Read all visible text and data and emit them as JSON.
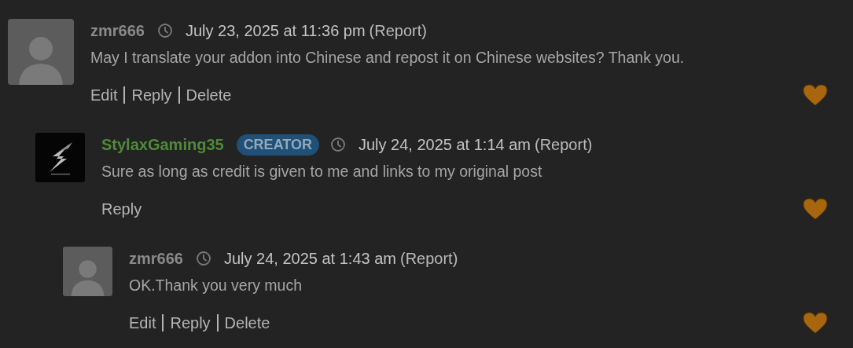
{
  "comments": [
    {
      "author": "zmr666",
      "avatar": {
        "kind": "default"
      },
      "date": "July 23, 2025 at 11:36 pm",
      "report": "(Report)",
      "text": "May I translate your addon into Chinese and repost it on Chinese websites? Thank you.",
      "actions": [
        "Edit",
        "Reply",
        "Delete"
      ],
      "children": [
        {
          "author": "StylaxGaming35",
          "badge": "CREATOR",
          "avatar": {
            "kind": "logo"
          },
          "date": "July 24, 2025 at 1:14 am",
          "report": "(Report)",
          "text": "Sure as long as credit is given to me and links to my original post",
          "actions": [
            "Reply"
          ],
          "children": [
            {
              "author": "zmr666",
              "avatar": {
                "kind": "default"
              },
              "date": "July 24, 2025 at 1:43 am",
              "report": "(Report)",
              "text": "OK.Thank you very much",
              "actions": [
                "Edit",
                "Reply",
                "Delete"
              ]
            }
          ]
        }
      ]
    }
  ]
}
